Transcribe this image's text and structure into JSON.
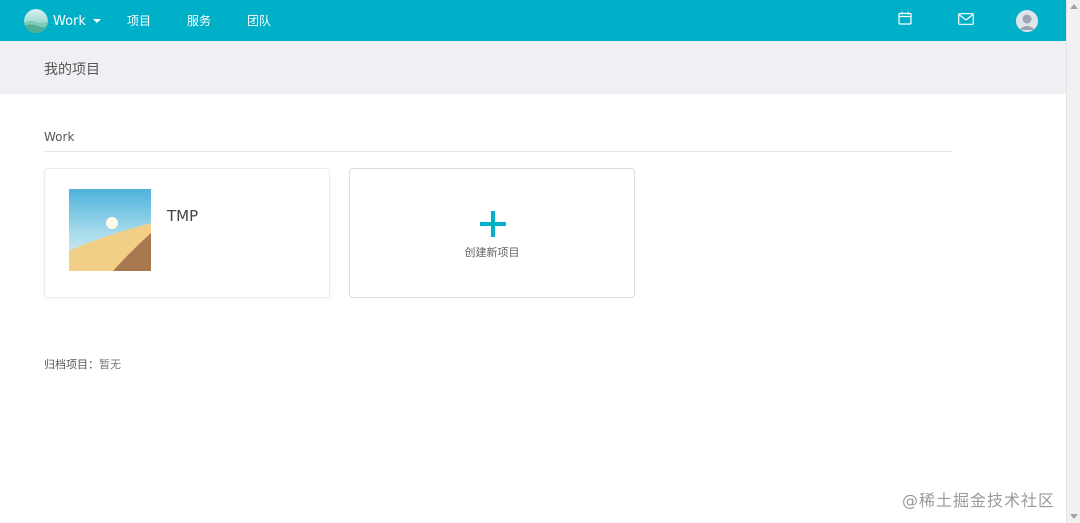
{
  "header": {
    "brand": "Work",
    "nav": [
      "项目",
      "服务",
      "团队"
    ],
    "icons": [
      "calendar-icon",
      "mail-icon"
    ],
    "accent_color": "#00b0c8"
  },
  "page": {
    "title": "我的项目"
  },
  "workspace": {
    "section_title": "Work",
    "projects": [
      {
        "name": "TMP"
      }
    ],
    "create_label": "创建新项目",
    "create_icon": "plus-icon"
  },
  "archive": {
    "label": "归档项目：",
    "value": "暂无"
  },
  "watermark": "@稀土掘金技术社区"
}
